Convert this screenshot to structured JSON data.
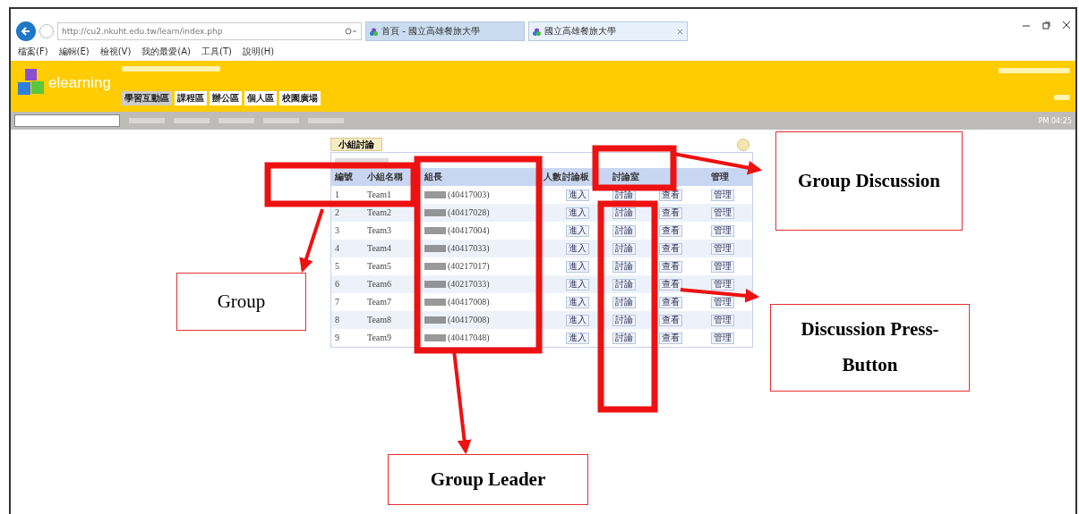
{
  "browser": {
    "url": "http://cu2.nkuht.edu.tw/learn/index.php",
    "tabs": [
      {
        "label": "首頁 - 國立高雄餐旅大學",
        "selected": false
      },
      {
        "label": "國立高雄餐旅大學",
        "selected": true
      }
    ],
    "menu": [
      "檔案(F)",
      "編輯(E)",
      "檢視(V)",
      "我的最愛(A)",
      "工具(T)",
      "說明(H)"
    ]
  },
  "site": {
    "logo": "elearning",
    "tabs": [
      {
        "label": "學習互動區",
        "selected": true
      },
      {
        "label": "課程區",
        "selected": false
      },
      {
        "label": "辦公區",
        "selected": false
      },
      {
        "label": "個人區",
        "selected": false
      },
      {
        "label": "校園廣場",
        "selected": false
      }
    ],
    "time": "PM 04:25"
  },
  "panel": {
    "title": "小組討論",
    "columns": [
      "編號",
      "小組名稱",
      "組長",
      "人數",
      "討論板",
      "討論室",
      "",
      "管理"
    ],
    "rows": [
      {
        "no": "1",
        "group": "Team1",
        "leader": "(40417003)",
        "buttons": [
          "進入",
          "討論",
          "查看",
          "管理"
        ]
      },
      {
        "no": "2",
        "group": "Team2",
        "leader": "(40417028)",
        "buttons": [
          "進入",
          "討論",
          "查看",
          "管理"
        ]
      },
      {
        "no": "3",
        "group": "Team3",
        "leader": "(40417004)",
        "buttons": [
          "進入",
          "討論",
          "查看",
          "管理"
        ]
      },
      {
        "no": "4",
        "group": "Team4",
        "leader": "(40417033)",
        "buttons": [
          "進入",
          "討論",
          "查看",
          "管理"
        ]
      },
      {
        "no": "5",
        "group": "Team5",
        "leader": "(40217017)",
        "buttons": [
          "進入",
          "討論",
          "查看",
          "管理"
        ]
      },
      {
        "no": "6",
        "group": "Team6",
        "leader": "(40217033)",
        "buttons": [
          "進入",
          "討論",
          "查看",
          "管理"
        ]
      },
      {
        "no": "7",
        "group": "Team7",
        "leader": "(40417008)",
        "buttons": [
          "進入",
          "討論",
          "查看",
          "管理"
        ]
      },
      {
        "no": "8",
        "group": "Team8",
        "leader": "(40417008)",
        "buttons": [
          "進入",
          "討論",
          "查看",
          "管理"
        ]
      },
      {
        "no": "9",
        "group": "Team9",
        "leader": "(40417048)",
        "buttons": [
          "進入",
          "討論",
          "查看",
          "管理"
        ]
      }
    ]
  },
  "annotations": [
    {
      "label": "Group",
      "bold": false
    },
    {
      "label": "Group Discussion",
      "bold": true
    },
    {
      "label": "Discussion Press-Button",
      "bold": true
    },
    {
      "label": "Group Leader",
      "bold": true
    }
  ]
}
